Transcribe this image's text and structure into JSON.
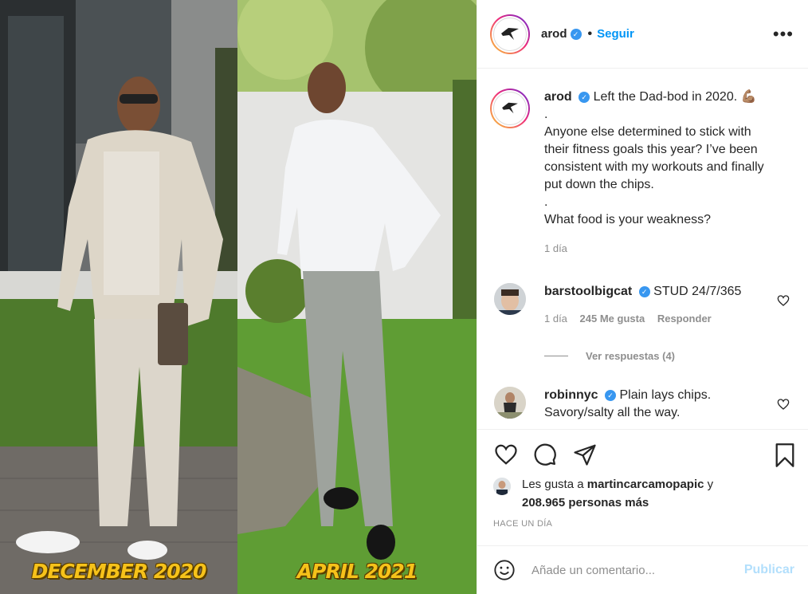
{
  "post": {
    "left_caption": "DECEMBER 2020",
    "right_caption": "APRIL 2021"
  },
  "header": {
    "username": "arod",
    "dot": "•",
    "follow_label": "Seguir",
    "more_icon": "more-options-icon"
  },
  "caption": {
    "username": "arod",
    "lines": [
      "Left the Dad-bod in 2020. 💪🏽",
      ".",
      "Anyone else determined to stick with their fitness goals this year? I’ve been consistent with my workouts and finally put down the chips.",
      ".",
      "What food is your weakness?"
    ],
    "time": "1 día"
  },
  "comments": [
    {
      "username": "barstoolbigcat",
      "text": "STUD 24/7/365",
      "time": "1 día",
      "likes": "245 Me gusta",
      "reply": "Responder",
      "view_replies": "Ver respuestas (4)"
    },
    {
      "username": "robinnyc",
      "text": "Plain lays chips. Savory/salty all the way."
    }
  ],
  "likes": {
    "prefix": "Les gusta a",
    "user": "martincarcamopapic",
    "and": "y",
    "others": "208.965 personas más"
  },
  "timestamp": "HACE UN DÍA",
  "comment_box": {
    "placeholder": "Añade un comentario...",
    "publish_label": "Publicar"
  },
  "colors": {
    "accent": "#0095f6",
    "verified": "#3897f0",
    "caption_yellow": "#f6c21a"
  }
}
